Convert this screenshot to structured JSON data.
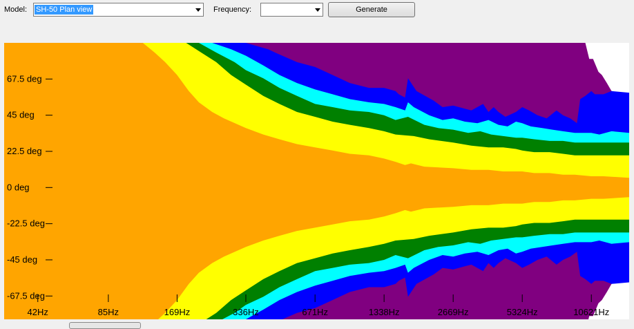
{
  "toolbar": {
    "model_label": "Model:",
    "model_value": "SH-50 Plan view",
    "frequency_label": "Frequency:",
    "frequency_value": "",
    "generate_label": "Generate"
  },
  "icons": {
    "dropdown": "chevron-down-icon"
  },
  "chart_data": {
    "type": "heatmap",
    "title": "",
    "xlabel": "",
    "ylabel": "",
    "x_scale": "log",
    "x_ticks": [
      {
        "hz": 42,
        "label": "42Hz"
      },
      {
        "hz": 85,
        "label": "85Hz"
      },
      {
        "hz": 169,
        "label": "169Hz"
      },
      {
        "hz": 336,
        "label": "336Hz"
      },
      {
        "hz": 671,
        "label": "671Hz"
      },
      {
        "hz": 1338,
        "label": "1338Hz"
      },
      {
        "hz": 2669,
        "label": "2669Hz"
      },
      {
        "hz": 5324,
        "label": "5324Hz"
      },
      {
        "hz": 10621,
        "label": "10621Hz"
      }
    ],
    "y_ticks": [
      {
        "deg": 67.5,
        "label": "67.5 deg"
      },
      {
        "deg": 45,
        "label": "45 deg"
      },
      {
        "deg": 22.5,
        "label": "22.5 deg"
      },
      {
        "deg": 0,
        "label": "0 deg"
      },
      {
        "deg": -22.5,
        "label": "-22.5 deg"
      },
      {
        "deg": -45,
        "label": "-45 deg"
      },
      {
        "deg": -67.5,
        "label": "-67.5 deg"
      }
    ],
    "ylim": [
      -82,
      90
    ],
    "xlim": [
      30,
      15500
    ],
    "background_color": "#ffffff",
    "bands": [
      {
        "color": "#800080",
        "edge": [
          [
            30,
            90
          ],
          [
            10000,
            90
          ],
          [
            10400,
            80
          ],
          [
            10800,
            80
          ],
          [
            11400,
            72
          ],
          [
            11800,
            70
          ],
          [
            12400,
            65
          ],
          [
            13000,
            60
          ],
          [
            14000,
            58
          ],
          [
            15000,
            55
          ]
        ]
      },
      {
        "color": "#0000ff",
        "edge": [
          [
            30,
            90
          ],
          [
            336,
            90
          ],
          [
            420,
            86
          ],
          [
            450,
            84
          ],
          [
            560,
            78
          ],
          [
            671,
            75
          ],
          [
            800,
            70
          ],
          [
            950,
            65
          ],
          [
            1150,
            62
          ],
          [
            1338,
            62
          ],
          [
            1500,
            60
          ],
          [
            1550,
            58
          ],
          [
            1650,
            56
          ],
          [
            1700,
            68
          ],
          [
            1850,
            60
          ],
          [
            2200,
            54
          ],
          [
            2400,
            50
          ],
          [
            2669,
            51
          ],
          [
            3000,
            49
          ],
          [
            3200,
            48
          ],
          [
            3600,
            52
          ],
          [
            3800,
            47
          ],
          [
            4000,
            50
          ],
          [
            4200,
            47
          ],
          [
            4500,
            44
          ],
          [
            5000,
            47
          ],
          [
            5324,
            50
          ],
          [
            5700,
            48
          ],
          [
            6200,
            45
          ],
          [
            6800,
            43
          ],
          [
            7500,
            48
          ],
          [
            8000,
            45
          ],
          [
            8600,
            43
          ],
          [
            9200,
            40
          ],
          [
            9500,
            55
          ],
          [
            10000,
            57
          ],
          [
            10621,
            60
          ],
          [
            11000,
            58
          ],
          [
            12000,
            58
          ],
          [
            13000,
            60
          ],
          [
            15500,
            59
          ]
        ]
      },
      {
        "color": "#00ffff",
        "edge": [
          [
            30,
            90
          ],
          [
            240,
            90
          ],
          [
            290,
            86
          ],
          [
            336,
            82
          ],
          [
            400,
            76
          ],
          [
            470,
            70
          ],
          [
            560,
            65
          ],
          [
            671,
            61
          ],
          [
            800,
            58
          ],
          [
            950,
            55
          ],
          [
            1150,
            53
          ],
          [
            1338,
            52
          ],
          [
            1500,
            50
          ],
          [
            1650,
            48
          ],
          [
            1700,
            53
          ],
          [
            1800,
            50
          ],
          [
            2100,
            45
          ],
          [
            2400,
            42
          ],
          [
            2669,
            43
          ],
          [
            3000,
            41
          ],
          [
            3400,
            40
          ],
          [
            3800,
            42
          ],
          [
            4200,
            39
          ],
          [
            4600,
            38
          ],
          [
            5000,
            41
          ],
          [
            5324,
            40
          ],
          [
            5800,
            38
          ],
          [
            6500,
            37
          ],
          [
            7200,
            36
          ],
          [
            8000,
            35
          ],
          [
            9000,
            34
          ],
          [
            10000,
            34
          ],
          [
            10621,
            34
          ],
          [
            11500,
            33
          ],
          [
            13000,
            35
          ],
          [
            15500,
            34
          ]
        ]
      },
      {
        "color": "#008000",
        "edge": [
          [
            30,
            90
          ],
          [
            210,
            90
          ],
          [
            250,
            84
          ],
          [
            300,
            78
          ],
          [
            336,
            73
          ],
          [
            400,
            68
          ],
          [
            470,
            62
          ],
          [
            560,
            57
          ],
          [
            671,
            52
          ],
          [
            800,
            50
          ],
          [
            950,
            48
          ],
          [
            1150,
            47
          ],
          [
            1338,
            45
          ],
          [
            1500,
            42
          ],
          [
            1700,
            44
          ],
          [
            2000,
            39
          ],
          [
            2300,
            37
          ],
          [
            2669,
            36
          ],
          [
            3100,
            34
          ],
          [
            3500,
            35
          ],
          [
            3900,
            33
          ],
          [
            4400,
            32
          ],
          [
            5000,
            31
          ],
          [
            5324,
            31
          ],
          [
            6000,
            30
          ],
          [
            7000,
            29
          ],
          [
            8000,
            29
          ],
          [
            9000,
            28
          ],
          [
            10000,
            28
          ],
          [
            10621,
            28
          ],
          [
            12000,
            28
          ],
          [
            15500,
            28
          ]
        ]
      },
      {
        "color": "#ffff00",
        "edge": [
          [
            30,
            90
          ],
          [
            185,
            90
          ],
          [
            215,
            84
          ],
          [
            250,
            78
          ],
          [
            290,
            70
          ],
          [
            336,
            64
          ],
          [
            400,
            57
          ],
          [
            470,
            52
          ],
          [
            560,
            47
          ],
          [
            671,
            44
          ],
          [
            800,
            41
          ],
          [
            950,
            39
          ],
          [
            1150,
            37
          ],
          [
            1338,
            35
          ],
          [
            1500,
            33
          ],
          [
            1800,
            32
          ],
          [
            2100,
            30
          ],
          [
            2669,
            28
          ],
          [
            3200,
            26
          ],
          [
            3800,
            25
          ],
          [
            4400,
            25
          ],
          [
            5000,
            24
          ],
          [
            5324,
            23
          ],
          [
            6000,
            22
          ],
          [
            7000,
            22
          ],
          [
            8000,
            21
          ],
          [
            9000,
            20
          ],
          [
            10000,
            20
          ],
          [
            10621,
            20
          ],
          [
            12000,
            20
          ],
          [
            15500,
            20
          ]
        ]
      },
      {
        "color": "#ffa500",
        "edge": [
          [
            30,
            90
          ],
          [
            120,
            90
          ],
          [
            135,
            84
          ],
          [
            150,
            78
          ],
          [
            169,
            70
          ],
          [
            190,
            60
          ],
          [
            210,
            53
          ],
          [
            240,
            47
          ],
          [
            270,
            43
          ],
          [
            336,
            37
          ],
          [
            400,
            33
          ],
          [
            470,
            30
          ],
          [
            560,
            27
          ],
          [
            671,
            25
          ],
          [
            800,
            23
          ],
          [
            950,
            21
          ],
          [
            1150,
            20
          ],
          [
            1338,
            18
          ],
          [
            1500,
            16
          ],
          [
            1650,
            14
          ],
          [
            1750,
            15
          ],
          [
            2000,
            13
          ],
          [
            2669,
            12
          ],
          [
            3200,
            11
          ],
          [
            3800,
            11
          ],
          [
            4400,
            10
          ],
          [
            5000,
            10
          ],
          [
            5324,
            10
          ],
          [
            6000,
            9
          ],
          [
            7000,
            9
          ],
          [
            8000,
            8
          ],
          [
            9000,
            8
          ],
          [
            10621,
            7
          ],
          [
            12000,
            7
          ],
          [
            15500,
            6
          ]
        ]
      },
      {
        "color": "#ff0000",
        "edge": [
          [
            30,
            0
          ],
          [
            15500,
            0
          ]
        ]
      }
    ]
  }
}
